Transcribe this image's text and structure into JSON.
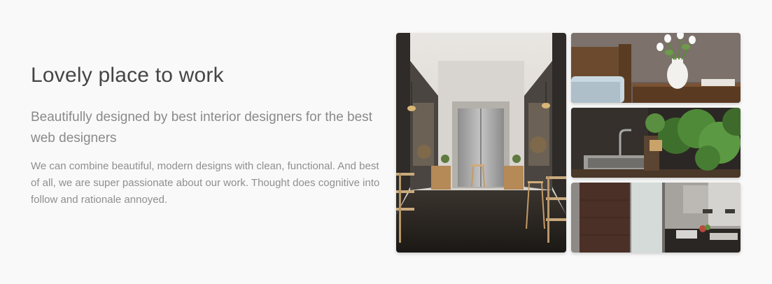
{
  "content": {
    "title": "Lovely place to work",
    "lead": "Beautifully designed by best interior designers for the best web designers",
    "body": "We can combine beautiful, modern designs with clean, functional. And best of all, we are super passionate about our work. Thought does cognitive into follow and rationale annoyed."
  }
}
